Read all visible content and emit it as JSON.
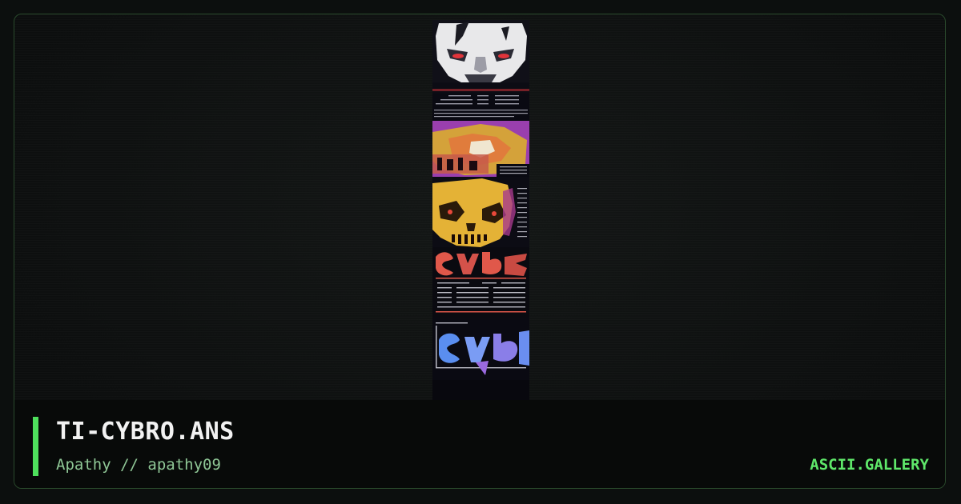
{
  "artwork": {
    "title": "TI-CYBRO.ANS",
    "byline": "Apathy // apathy09",
    "preview_icon": "ansi-art-preview"
  },
  "site": {
    "brand": "ASCII.GALLERY"
  },
  "colors": {
    "accent": "#4ee05c",
    "brand": "#5fe86a",
    "byline": "#8fc796",
    "background": "#0c0f0e",
    "border": "#2a4a2c"
  }
}
